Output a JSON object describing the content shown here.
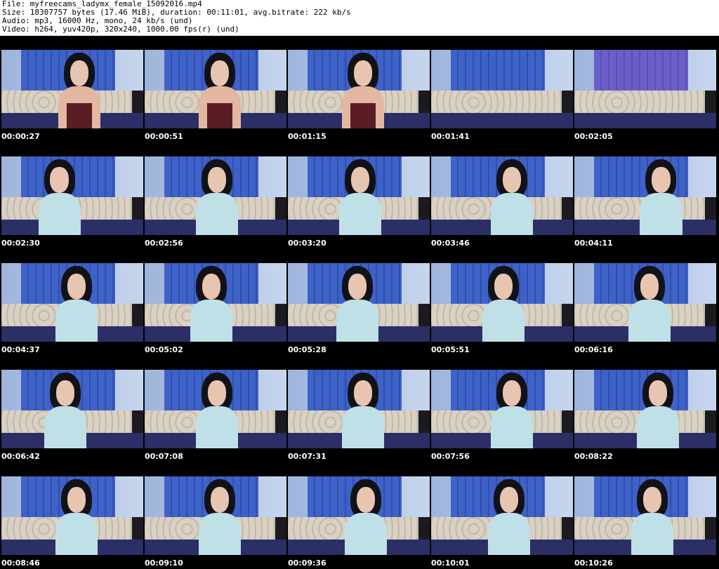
{
  "header": {
    "file_line": "File: myfreecams_ladymx_female_15092016.mp4",
    "size_line": "Size: 18307757 bytes (17.46 MiB), duration: 00:11:01, avg.bitrate: 222 kb/s",
    "audio_line": "Audio: mp3, 16000 Hz, mono, 24 kb/s (und)",
    "video_line": "Video: h264, yuv420p, 320x240, 1000.00 fps(r) (und)"
  },
  "thumbnails": [
    {
      "timestamp": "00:00:27"
    },
    {
      "timestamp": "00:00:51"
    },
    {
      "timestamp": "00:01:15"
    },
    {
      "timestamp": "00:01:41"
    },
    {
      "timestamp": "00:02:05"
    },
    {
      "timestamp": "00:02:30"
    },
    {
      "timestamp": "00:02:56"
    },
    {
      "timestamp": "00:03:20"
    },
    {
      "timestamp": "00:03:46"
    },
    {
      "timestamp": "00:04:11"
    },
    {
      "timestamp": "00:04:37"
    },
    {
      "timestamp": "00:05:02"
    },
    {
      "timestamp": "00:05:28"
    },
    {
      "timestamp": "00:05:51"
    },
    {
      "timestamp": "00:06:16"
    },
    {
      "timestamp": "00:06:42"
    },
    {
      "timestamp": "00:07:08"
    },
    {
      "timestamp": "00:07:31"
    },
    {
      "timestamp": "00:07:56"
    },
    {
      "timestamp": "00:08:22"
    },
    {
      "timestamp": "00:08:46"
    },
    {
      "timestamp": "00:09:10"
    },
    {
      "timestamp": "00:09:36"
    },
    {
      "timestamp": "00:10:01"
    },
    {
      "timestamp": "00:10:26"
    }
  ],
  "colors": {
    "background": "#ffffff",
    "grid_background": "#000000",
    "timestamp_text": "#ffffff",
    "header_text": "#000000"
  }
}
